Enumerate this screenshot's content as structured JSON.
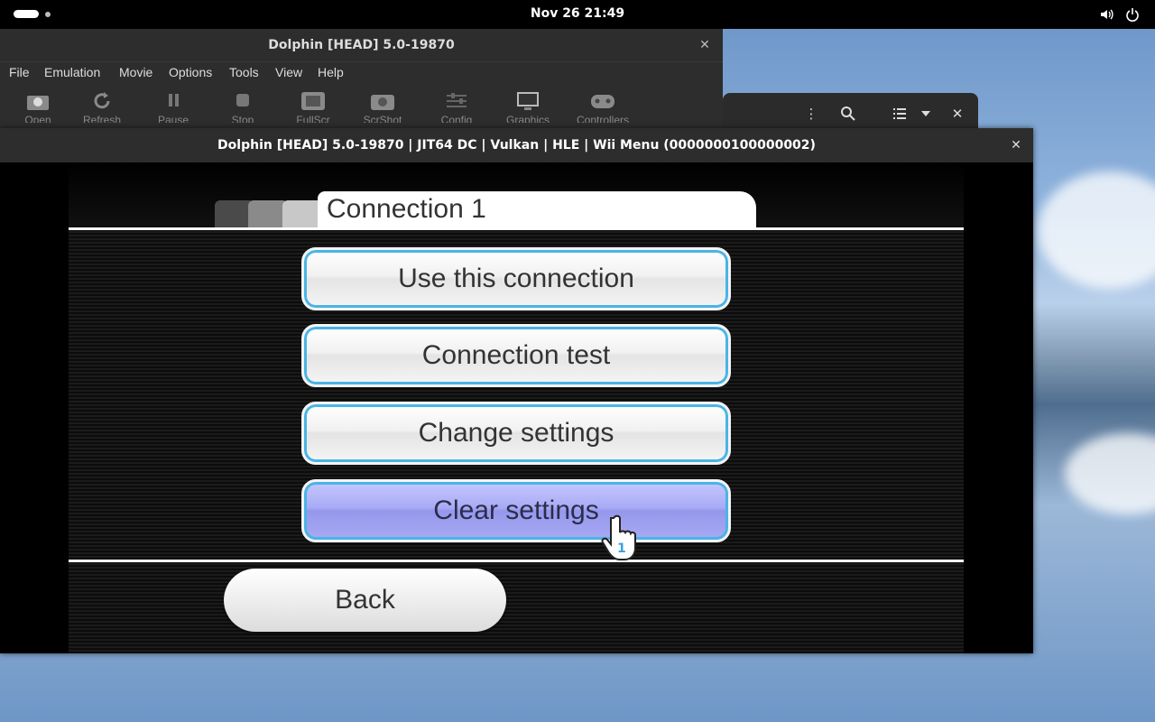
{
  "topbar": {
    "clock": "Nov 26  21:49"
  },
  "main_window": {
    "title": "Dolphin [HEAD] 5.0-19870",
    "menu": [
      "File",
      "Emulation",
      "Movie",
      "Options",
      "Tools",
      "View",
      "Help"
    ],
    "toolbar": [
      {
        "label": "Open",
        "icon": "open-icon"
      },
      {
        "label": "Refresh",
        "icon": "refresh-icon"
      },
      {
        "label": "Pause",
        "icon": "pause-icon"
      },
      {
        "label": "Stop",
        "icon": "stop-icon"
      },
      {
        "label": "FullScr",
        "icon": "fullscreen-icon"
      },
      {
        "label": "ScrShot",
        "icon": "screenshot-icon"
      },
      {
        "label": "Config",
        "icon": "config-icon"
      },
      {
        "label": "Graphics",
        "icon": "graphics-icon"
      },
      {
        "label": "Controllers",
        "icon": "controllers-icon"
      }
    ]
  },
  "render_window": {
    "title": "Dolphin [HEAD] 5.0-19870 | JIT64 DC | Vulkan | HLE | Wii Menu (0000000100000002)"
  },
  "wii_menu": {
    "tab_title": "Connection 1",
    "buttons": [
      {
        "label": "Use this connection",
        "highlighted": false
      },
      {
        "label": "Connection test",
        "highlighted": false
      },
      {
        "label": "Change settings",
        "highlighted": false
      },
      {
        "label": "Clear settings",
        "highlighted": true
      }
    ],
    "back_label": "Back",
    "cursor_player": "1"
  },
  "colors": {
    "button_border": "#4ab4e6",
    "highlight": "#a8aaf5"
  }
}
